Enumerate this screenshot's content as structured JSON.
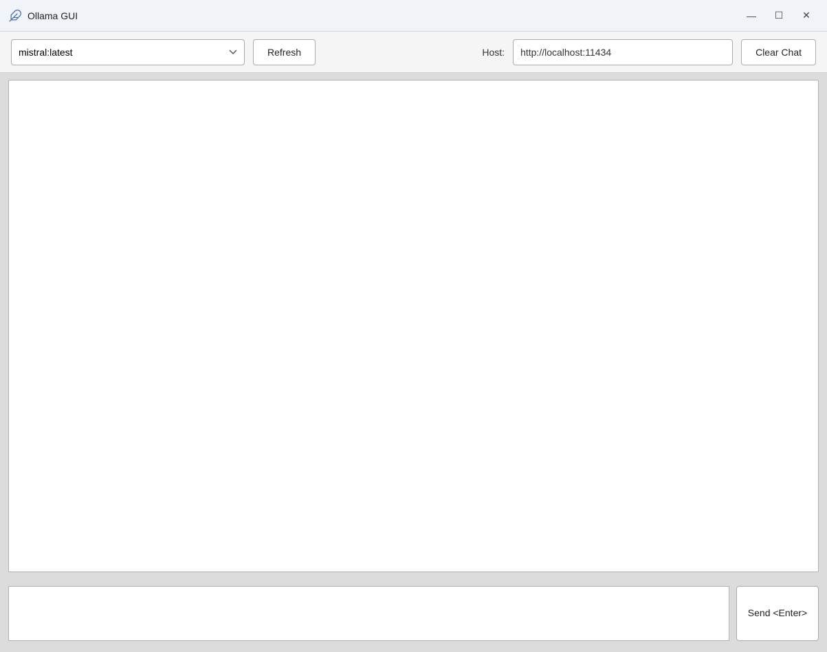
{
  "window": {
    "title": "Ollama GUI",
    "icon": "feather-icon"
  },
  "titlebar": {
    "controls": {
      "minimize_label": "—",
      "maximize_label": "☐",
      "close_label": "✕"
    }
  },
  "toolbar": {
    "model_select": {
      "value": "mistral:latest",
      "options": [
        "mistral:latest"
      ]
    },
    "refresh_label": "Refresh",
    "host_label": "Host:",
    "host_value": "http://localhost:11434",
    "clear_chat_label": "Clear Chat"
  },
  "chat": {
    "messages": []
  },
  "input": {
    "placeholder": "",
    "send_label": "Send\n<Enter>"
  }
}
